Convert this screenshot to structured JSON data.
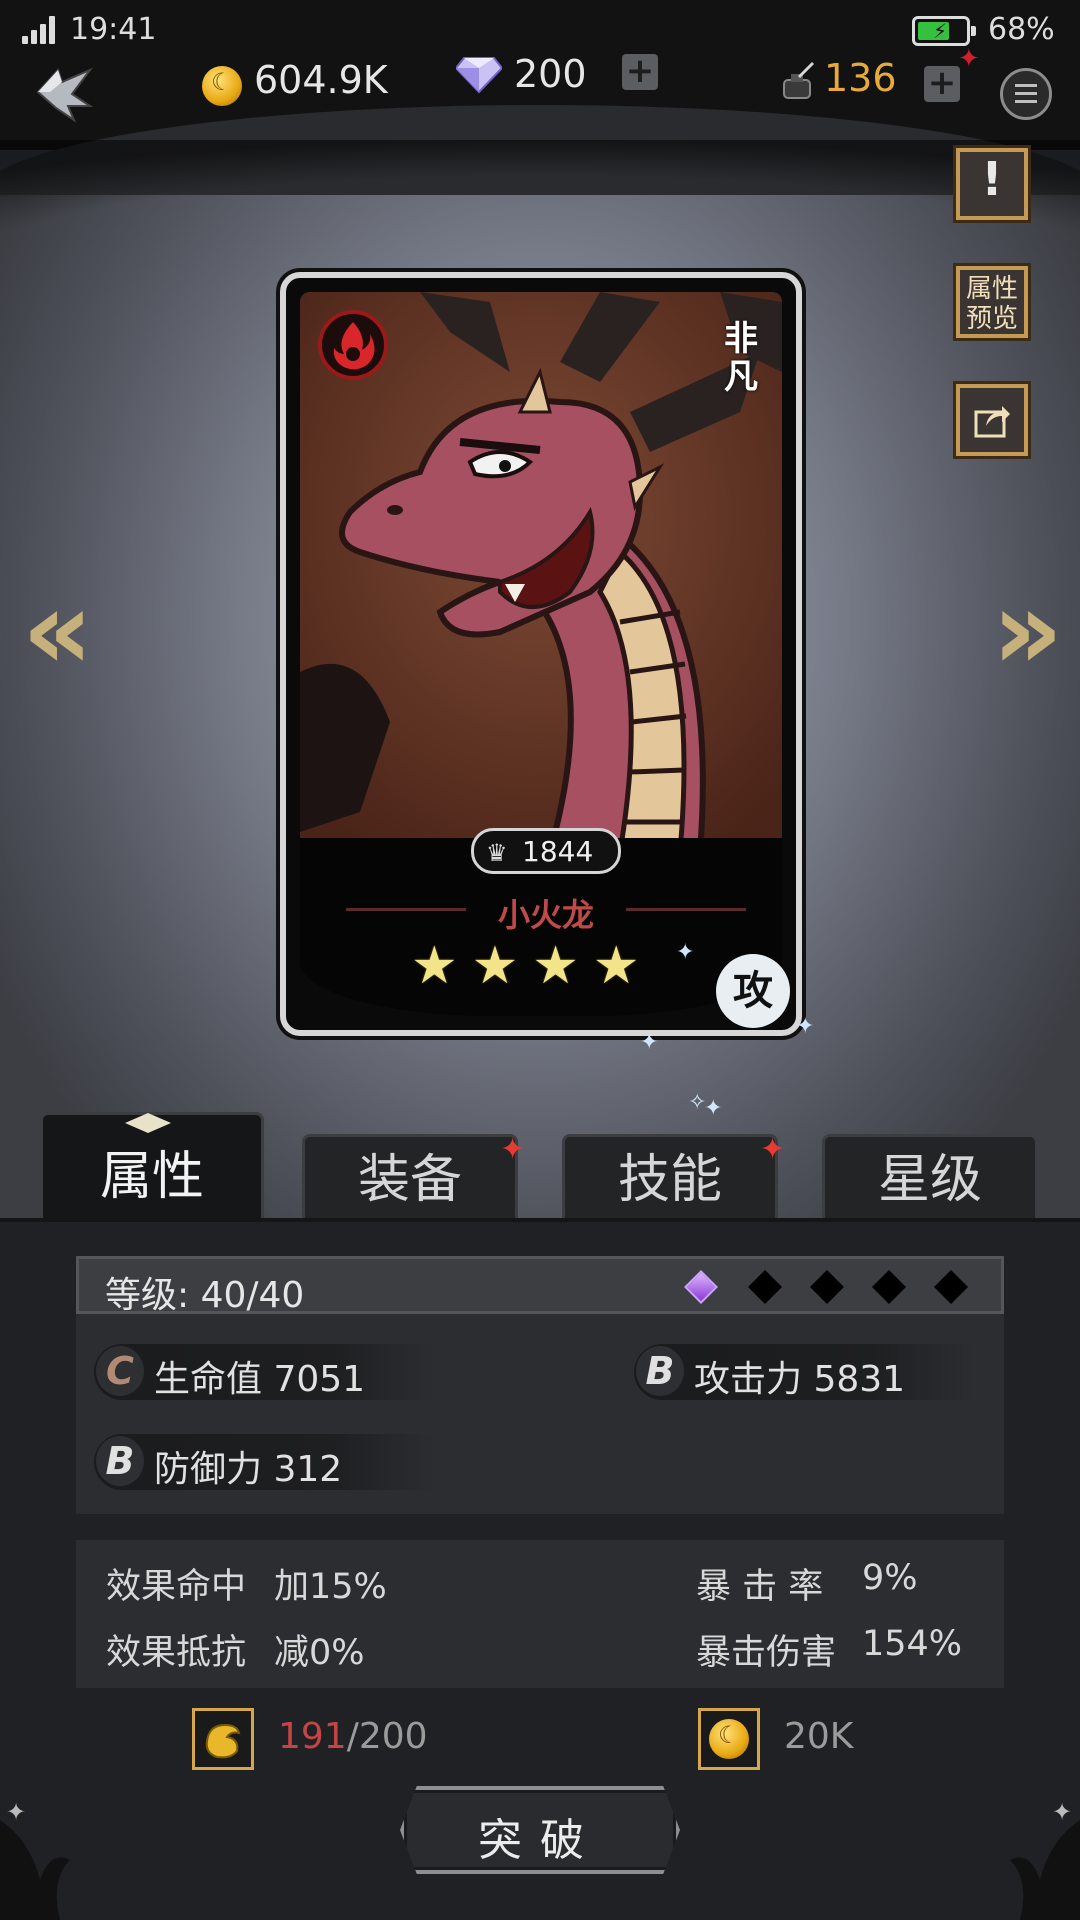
{
  "status_bar": {
    "time": "19:41",
    "battery_percent": "68%",
    "battery_level": 0.68
  },
  "currencies": {
    "gold": "604.9K",
    "gems": "200",
    "ink": "136"
  },
  "side_buttons": {
    "info": "!",
    "attr_preview_line1": "属性",
    "attr_preview_line2": "预览"
  },
  "card": {
    "rarity": "非凡",
    "power": "1844",
    "name": "小火龙",
    "stars": 4,
    "role": "攻",
    "element": "fire"
  },
  "tabs": [
    {
      "label": "属性",
      "active": true,
      "badge": false
    },
    {
      "label": "装备",
      "active": false,
      "badge": true
    },
    {
      "label": "技能",
      "active": false,
      "badge": true
    },
    {
      "label": "星级",
      "active": false,
      "badge": false
    }
  ],
  "level": {
    "label": "等级: 40/40",
    "breakthrough_filled": 1,
    "breakthrough_total": 5
  },
  "stats": [
    {
      "grade": "C",
      "text": "生命值 7051"
    },
    {
      "grade": "B",
      "text": "攻击力 5831"
    },
    {
      "grade": "B",
      "text": "防御力 312"
    }
  ],
  "sub_stats": {
    "effect_hit_label": "效果命中",
    "effect_hit_value": "加15%",
    "effect_resist_label": "效果抵抗",
    "effect_resist_value": "减0%",
    "crit_rate_label": "暴 击 率",
    "crit_rate_value": "9%",
    "crit_dmg_label": "暴击伤害",
    "crit_dmg_value": "154%"
  },
  "costs": {
    "material_have": "191",
    "material_sep": "/200",
    "gold_cost": "20K"
  },
  "break_button": "突破",
  "colors": {
    "accent_gold": "#c59a55",
    "ink_orange": "#e7ab3b",
    "badge_red": "#e63a33",
    "cost_red": "#c44545"
  }
}
